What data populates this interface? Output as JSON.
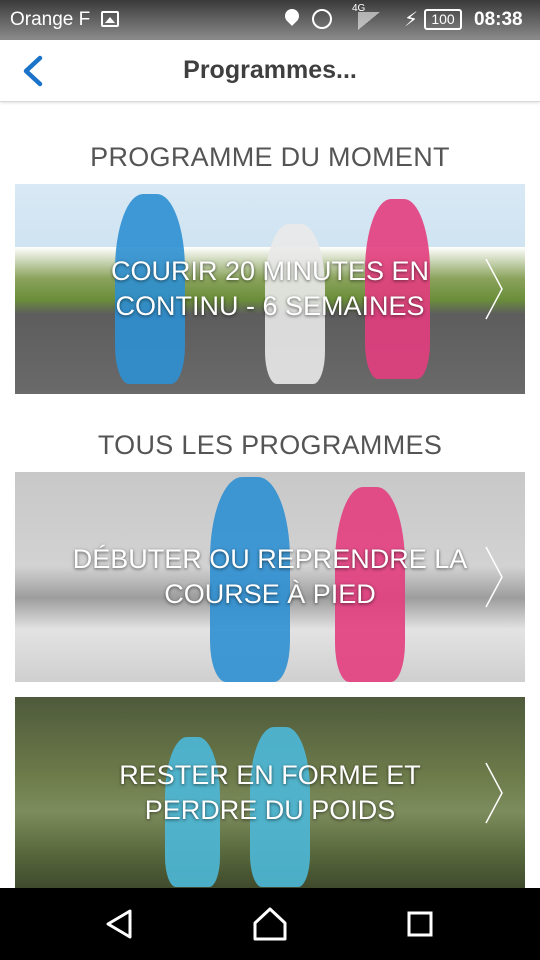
{
  "status_bar": {
    "carrier": "Orange F",
    "network": "4G",
    "battery": "100",
    "time": "08:38"
  },
  "header": {
    "title": "Programmes...",
    "back_icon": "chevron-left-icon"
  },
  "sections": {
    "featured_heading": "PROGRAMME DU MOMENT",
    "all_heading": "TOUS LES PROGRAMMES"
  },
  "cards": [
    {
      "title": "COURIR 20 MINUTES EN CONTINU - 6 SEMAINES"
    },
    {
      "title": "DÉBUTER OU REPRENDRE LA COURSE À PIED"
    },
    {
      "title": "RESTER EN FORME ET PERDRE DU POIDS"
    }
  ],
  "nav": {
    "back": "back-triangle-icon",
    "home": "home-icon",
    "recents": "recents-square-icon"
  },
  "colors": {
    "accent": "#1a73c9",
    "title_text": "#3f3f3f",
    "heading_text": "#555555"
  }
}
